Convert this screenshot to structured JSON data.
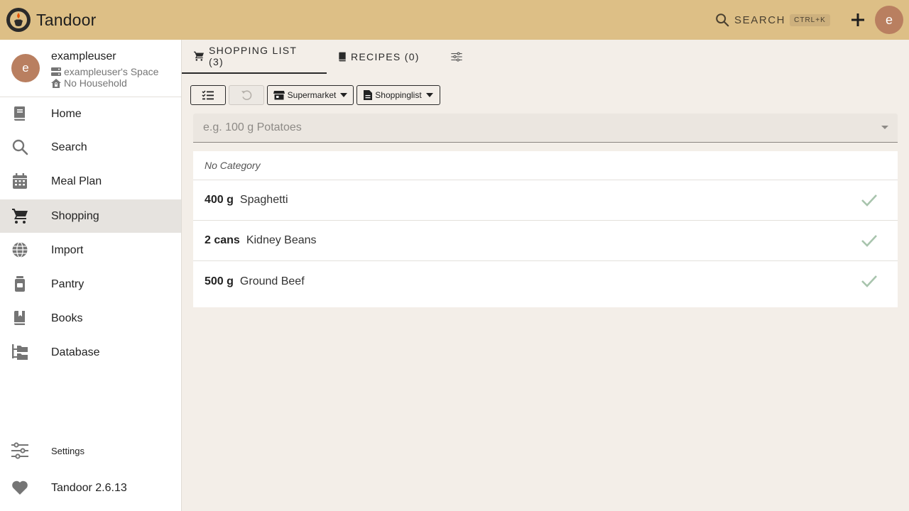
{
  "app": {
    "title": "Tandoor"
  },
  "topbar": {
    "search_label": "SEARCH",
    "search_shortcut": "CTRL+K",
    "avatar_letter": "e"
  },
  "user": {
    "avatar_letter": "e",
    "name": "exampleuser",
    "space": "exampleuser's Space",
    "household": "No Household"
  },
  "sidebar": {
    "items": [
      {
        "label": "Home",
        "icon": "book-icon"
      },
      {
        "label": "Search",
        "icon": "search-icon"
      },
      {
        "label": "Meal Plan",
        "icon": "calendar-icon"
      },
      {
        "label": "Shopping",
        "icon": "cart-icon",
        "active": true
      },
      {
        "label": "Import",
        "icon": "globe-icon"
      },
      {
        "label": "Pantry",
        "icon": "jar-icon"
      },
      {
        "label": "Books",
        "icon": "bookmark-book-icon"
      },
      {
        "label": "Database",
        "icon": "folder-tree-icon"
      }
    ],
    "bottom": [
      {
        "label": "Settings",
        "icon": "sliders-icon"
      },
      {
        "label": "Tandoor 2.6.13",
        "icon": "heart-icon"
      }
    ]
  },
  "tabs": [
    {
      "label": "SHOPPING LIST (3)",
      "icon": "cart-icon",
      "active": true
    },
    {
      "label": "RECIPES (0)",
      "icon": "book-icon"
    },
    {
      "label": "",
      "icon": "sliders-icon"
    }
  ],
  "toolbar": {
    "supermarket_label": "Supermarket",
    "shoppinglist_label": "Shoppinglist"
  },
  "add_entry": {
    "placeholder": "e.g. 100 g Potatoes"
  },
  "list": {
    "category": "No Category",
    "entries": [
      {
        "amount": "400 g",
        "food": "Spaghetti"
      },
      {
        "amount": "2 cans",
        "food": "Kidney Beans"
      },
      {
        "amount": "500 g",
        "food": "Ground Beef"
      }
    ]
  },
  "colors": {
    "topbar": "#ddbf86",
    "avatar": "#b97f60",
    "check": "#a8c4ad",
    "background": "#f3eee8"
  }
}
